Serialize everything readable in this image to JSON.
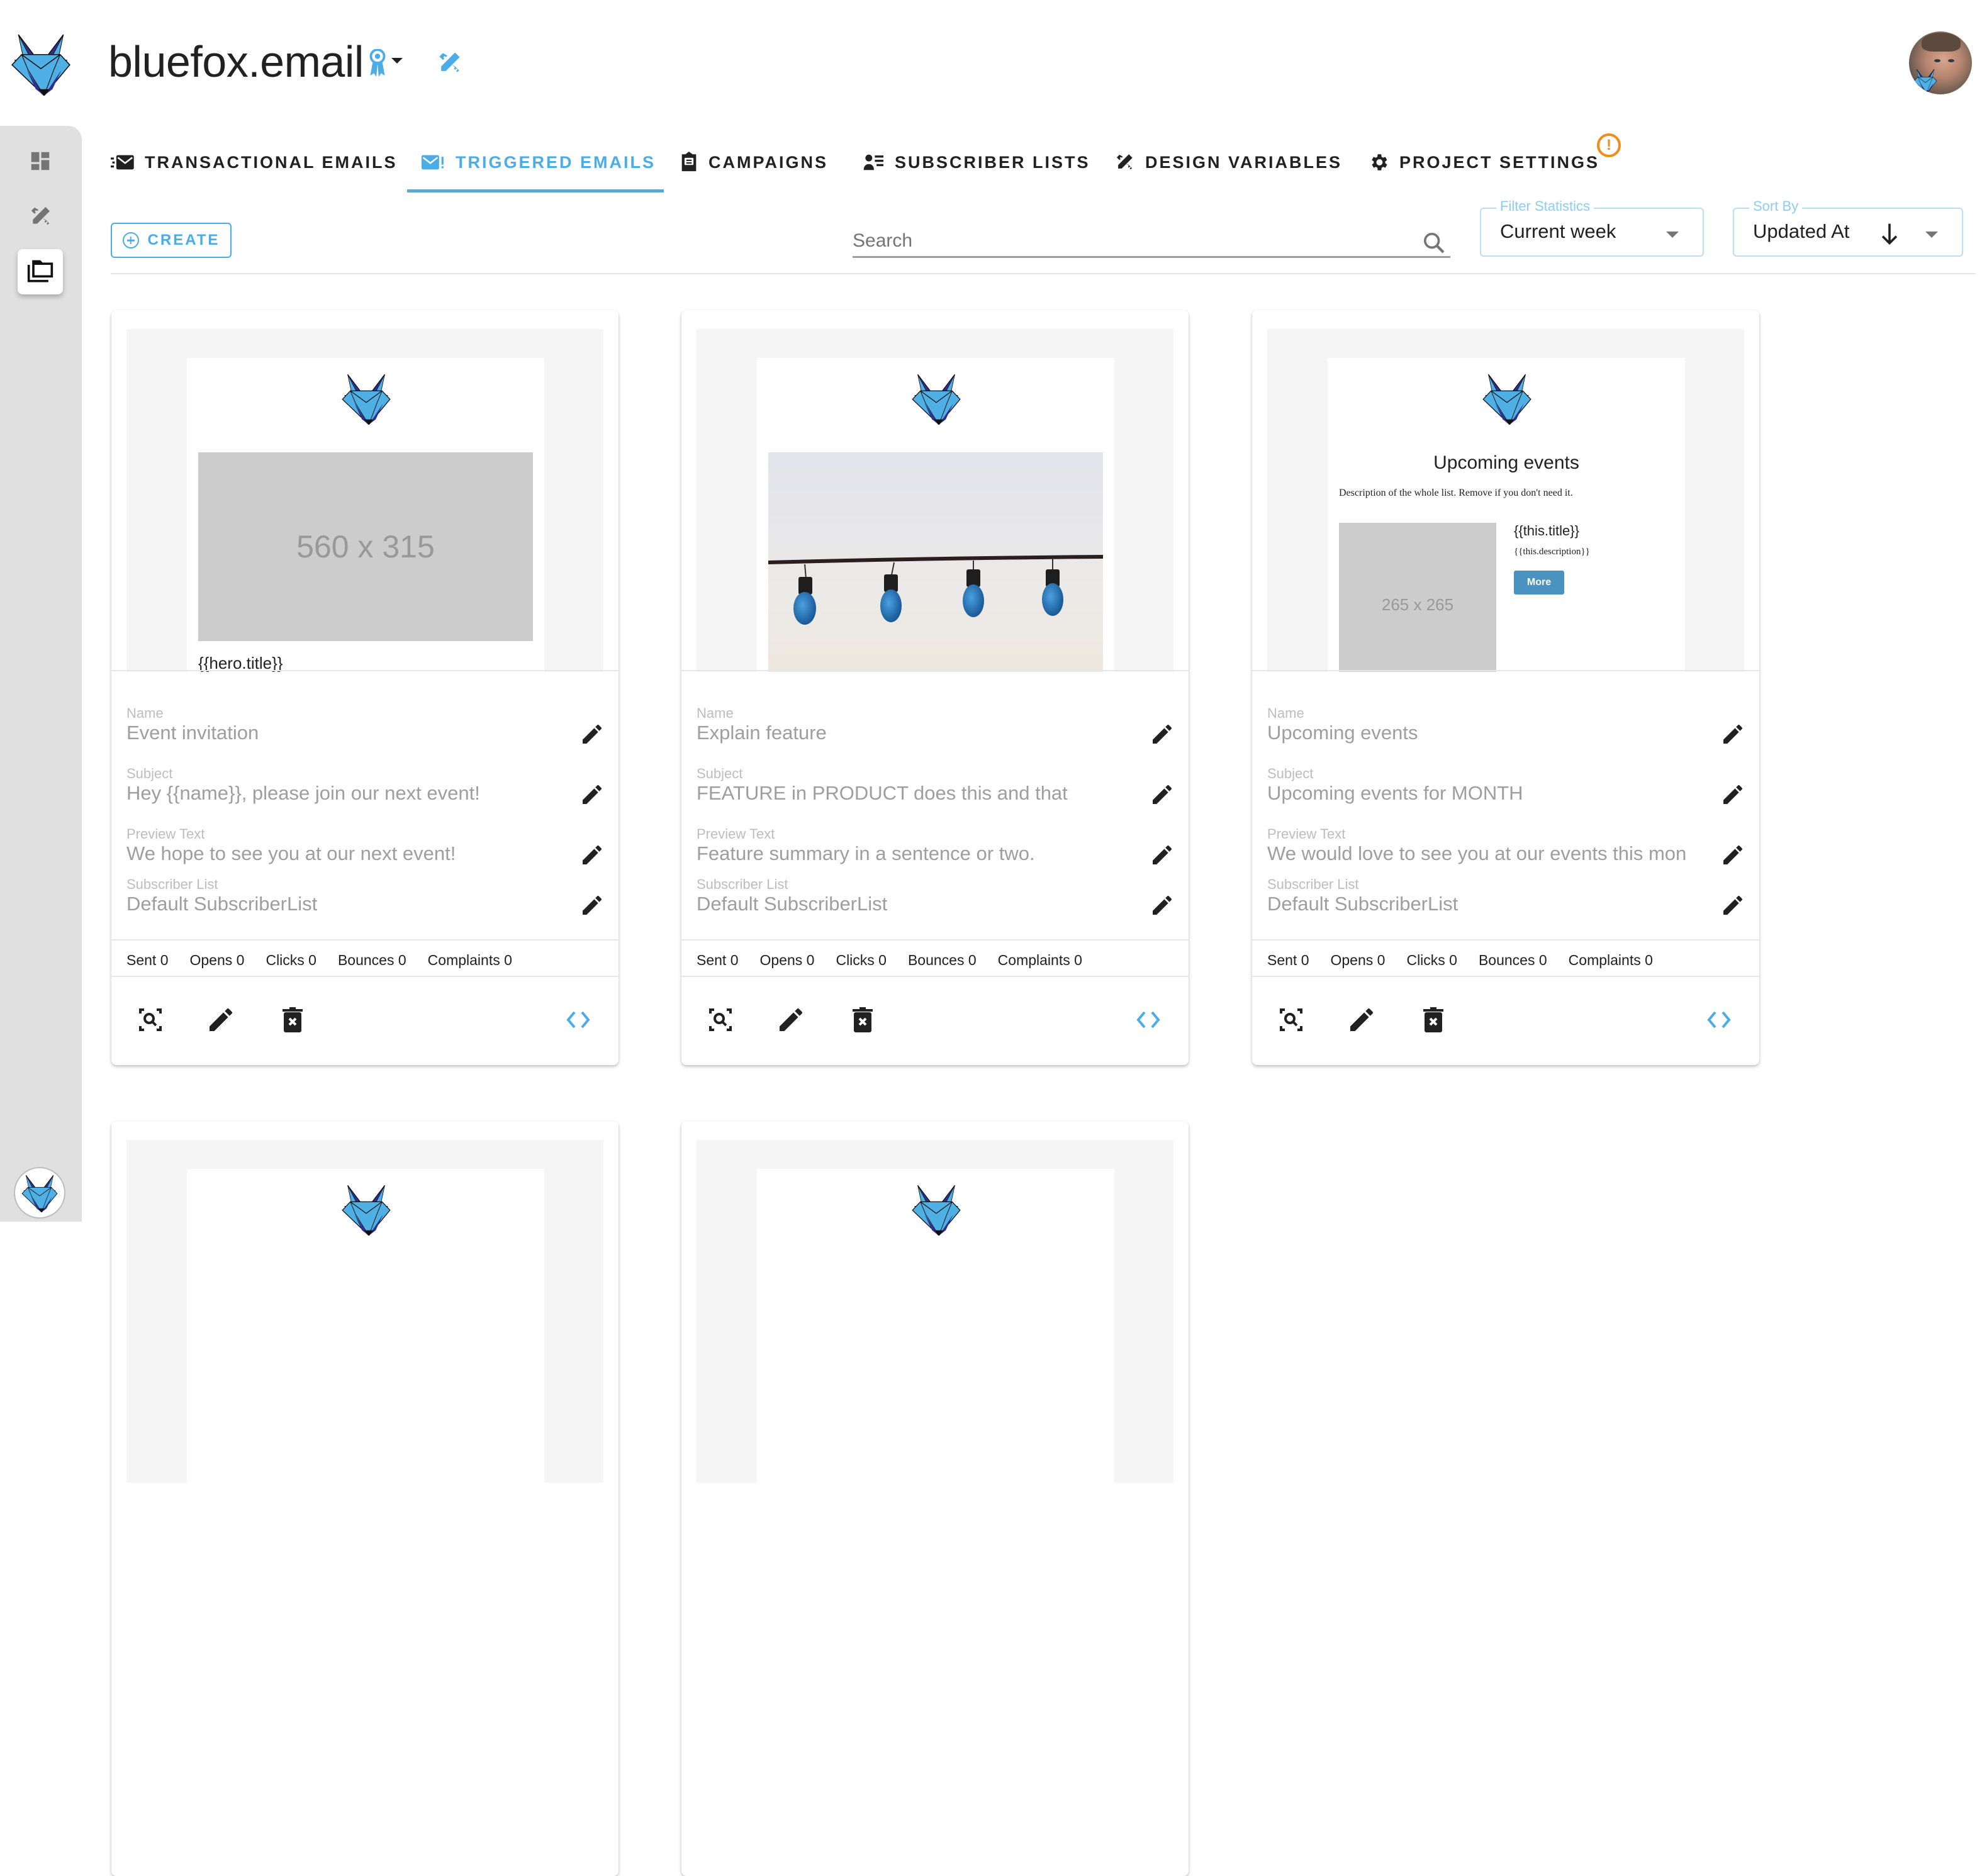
{
  "header": {
    "title": "bluefox.email",
    "logo_icon": "bluefox-logo-icon",
    "badge_icon": "award-ribbon-icon",
    "design_icon": "design-tools-icon",
    "avatar_alt": "user-avatar"
  },
  "sidebar": {
    "items": [
      {
        "name": "dashboard",
        "icon": "dashboard-icon",
        "active": false
      },
      {
        "name": "design",
        "icon": "design-tools-icon",
        "active": false
      },
      {
        "name": "projects",
        "icon": "folder-copy-icon",
        "active": true
      }
    ],
    "bottom_icon": "bluefox-logo-icon"
  },
  "tabs": [
    {
      "label": "TRANSACTIONAL EMAILS",
      "icon": "email-fast-icon",
      "active": false
    },
    {
      "label": "TRIGGERED EMAILS",
      "icon": "email-alert-icon",
      "active": true
    },
    {
      "label": "CAMPAIGNS",
      "icon": "email-campaign-icon",
      "active": false
    },
    {
      "label": "SUBSCRIBER LISTS",
      "icon": "account-list-icon",
      "active": false
    },
    {
      "label": "DESIGN VARIABLES",
      "icon": "design-tools-icon",
      "active": false
    },
    {
      "label": "PROJECT SETTINGS",
      "icon": "gear-icon",
      "active": false,
      "warning": "!"
    }
  ],
  "toolbar": {
    "create_label": "CREATE",
    "search_placeholder": "Search",
    "search_value": "",
    "filter": {
      "legend": "Filter Statistics",
      "value": "Current week"
    },
    "sort": {
      "legend": "Sort By",
      "value": "Updated At",
      "direction": "descending"
    }
  },
  "field_labels": {
    "name": "Name",
    "subject": "Subject",
    "preview": "Preview Text",
    "list": "Subscriber List"
  },
  "cards": [
    {
      "preview": {
        "placeholder": "560 x 315",
        "hero_title": "{{hero.title}}"
      },
      "name": "Event invitation",
      "subject": "Hey {{name}}, please join our next event!",
      "preview_text": "We hope to see you at our next event!",
      "subscriber_list": "Default SubscriberList",
      "stats": {
        "sent": "Sent 0",
        "opens": "Opens 0",
        "clicks": "Clicks 0",
        "bounces": "Bounces 0",
        "complaints": "Complaints 0"
      }
    },
    {
      "preview": {
        "image": "light-bulbs-photo"
      },
      "name": "Explain feature",
      "subject": "FEATURE in PRODUCT does this and that",
      "preview_text": "Feature summary in a sentence or two.",
      "subscriber_list": "Default SubscriberList",
      "stats": {
        "sent": "Sent 0",
        "opens": "Opens 0",
        "clicks": "Clicks 0",
        "bounces": "Bounces 0",
        "complaints": "Complaints 0"
      }
    },
    {
      "preview": {
        "title": "Upcoming events",
        "description": "Description of the whole list. Remove if you don't need it.",
        "placeholder": "265 x 265",
        "item_title": "{{this.title}}",
        "item_description": "{{this.description}}",
        "button": "More"
      },
      "name": "Upcoming events",
      "subject": "Upcoming events for MONTH",
      "preview_text": "We would love to see you at our events this mon",
      "subscriber_list": "Default SubscriberList",
      "stats": {
        "sent": "Sent 0",
        "opens": "Opens 0",
        "clicks": "Clicks 0",
        "bounces": "Bounces 0",
        "complaints": "Complaints 0"
      }
    }
  ],
  "card_actions": [
    "preview-icon",
    "edit-icon",
    "delete-icon",
    "code-icon"
  ],
  "colors": {
    "accent": "#4aade8",
    "warning": "#f08c1e",
    "sidebar_bg": "#e0e0e0",
    "fox_light": "#4fb0e6",
    "fox_dark": "#2e3192"
  }
}
